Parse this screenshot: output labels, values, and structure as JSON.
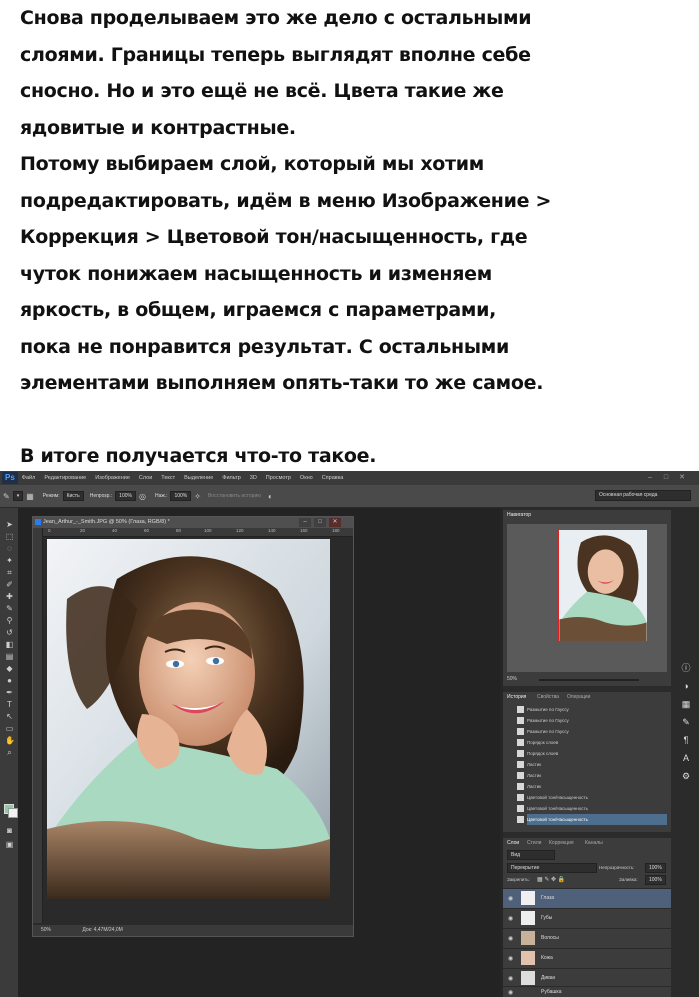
{
  "article": {
    "para1_lines": [
      "Снова проделываем это же дело с остальными",
      "слоями. Границы теперь выглядят вполне себе",
      "сносно. Но и это ещё не всё. Цвета такие же",
      "ядовитые и контрастные.",
      "Потому выбираем слой, который мы хотим",
      "подредактировать, идём в меню Изображение >",
      "Коррекция > Цветовой тон/насыщенность, где",
      "чуток понижаем насыщенность и изменяем",
      "яркость, в общем, играемся с параметрами,",
      "пока не понравится результат. С остальными",
      "элементами выполняем опять-таки то же самое."
    ],
    "para2": "В итоге получается что-то такое."
  },
  "ps": {
    "logo": "Ps",
    "menu": [
      "Файл",
      "Редактирование",
      "Изображение",
      "Слои",
      "Текст",
      "Выделение",
      "Фильтр",
      "3D",
      "Просмотр",
      "Окно",
      "Справка"
    ],
    "options": {
      "mode_label": "Режим:",
      "mode_value": "Кисть",
      "opacity_label": "Непрозр.:",
      "opacity_value": "100%",
      "flow_label": "Наж.:",
      "flow_value": "100%",
      "restore_label": "Восстановить историю",
      "workspace": "Основная рабочая среда"
    },
    "document": {
      "title": "Jean_Arthur_-_Smith.JPG @ 50% (Глаза, RGB/8) *",
      "ruler_marks": [
        "0",
        "20",
        "40",
        "60",
        "80",
        "100",
        "120",
        "140",
        "160",
        "180"
      ],
      "zoom": "50%",
      "doc_size": "Док: 4,47M/24,0M"
    },
    "navigator": {
      "tab": "Навигатор",
      "zoom": "50%"
    },
    "history": {
      "tabs": [
        "История",
        "Свойства",
        "Операции"
      ],
      "items": [
        "Размытие по Гауссу",
        "Размытие по Гауссу",
        "Размытие по Гауссу",
        "Порядок слоев",
        "Порядок слоев",
        "Ластик",
        "Ластик",
        "Ластик",
        "Цветовой тон/Насыщенность",
        "Цветовой тон/Насыщенность",
        "Цветовой тон/Насыщенность"
      ]
    },
    "layers": {
      "tabs": [
        "Слои",
        "Стили",
        "Коррекция",
        "Каналы"
      ],
      "filter": "Вид",
      "blend_mode": "Перекрытие",
      "opacity_label": "Непрозрачность:",
      "opacity_value": "100%",
      "lock_label": "Закрепить:",
      "fill_label": "Заливка:",
      "fill_value": "100%",
      "items": [
        "Глаза",
        "Губы",
        "Волосы",
        "Кожа",
        "Диван",
        "Рубашка"
      ]
    }
  },
  "colors": {
    "ps_accent": "#2b7de9",
    "selection": "#4e607a",
    "foreground_swatch": "#8fc9a6"
  }
}
